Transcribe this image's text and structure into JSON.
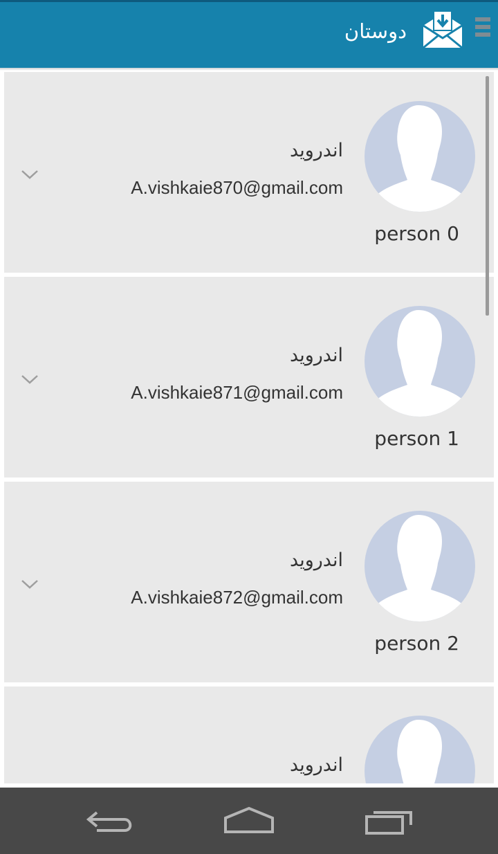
{
  "header": {
    "title": "دوستان",
    "app_icon": "mail-download-icon",
    "menu_icon": "overflow-menu-icon"
  },
  "contacts": [
    {
      "person": "person 0",
      "name": "اندروید",
      "email": "A.vishkaie870@gmail.com"
    },
    {
      "person": "person 1",
      "name": "اندروید",
      "email": "A.vishkaie871@gmail.com"
    },
    {
      "person": "person 2",
      "name": "اندروید",
      "email": "A.vishkaie872@gmail.com"
    },
    {
      "name": "اندروید"
    }
  ],
  "navbar": {
    "back_icon": "back-icon",
    "home_icon": "home-icon",
    "recents_icon": "recent-apps-icon"
  },
  "colors": {
    "appbar": "#1682ac",
    "card": "#e9e9e9",
    "avatar_bg": "#c5cfe3",
    "navbar": "#484848"
  }
}
